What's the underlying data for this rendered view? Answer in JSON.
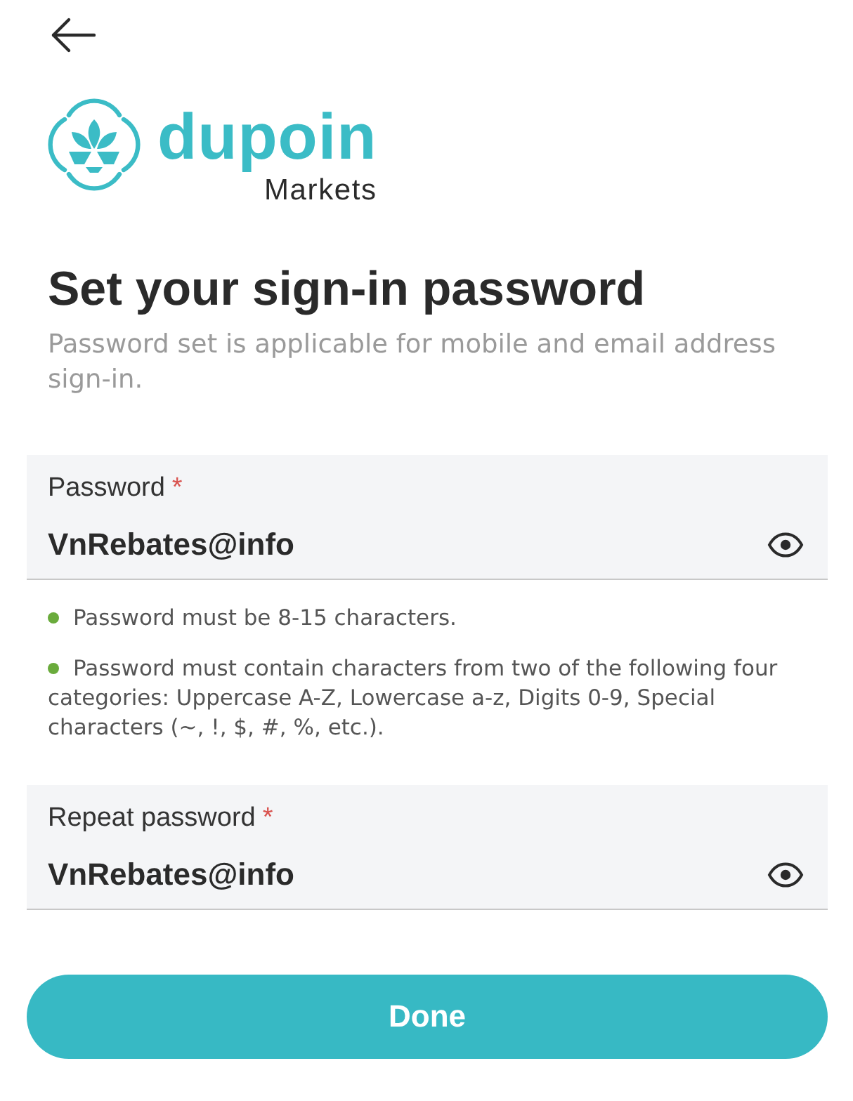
{
  "logo": {
    "wordmark": "dupoin",
    "tagline": "Markets"
  },
  "title": "Set your sign-in password",
  "subtitle": "Password set is applicable for mobile and email address sign-in.",
  "password_field": {
    "label": "Password",
    "required_mark": "*",
    "value": "VnRebates@info"
  },
  "password_rules": [
    {
      "text": "Password must be 8-15 characters.",
      "met": true
    },
    {
      "text": "Password must contain characters from two of the following four categories: Uppercase A-Z, Lowercase a-z, Digits 0-9, Special characters (~, !, $, #, %, etc.).",
      "met": true
    }
  ],
  "repeat_password_field": {
    "label": "Repeat password",
    "required_mark": "*",
    "value": "VnRebates@info"
  },
  "done_button": {
    "label": "Done"
  }
}
